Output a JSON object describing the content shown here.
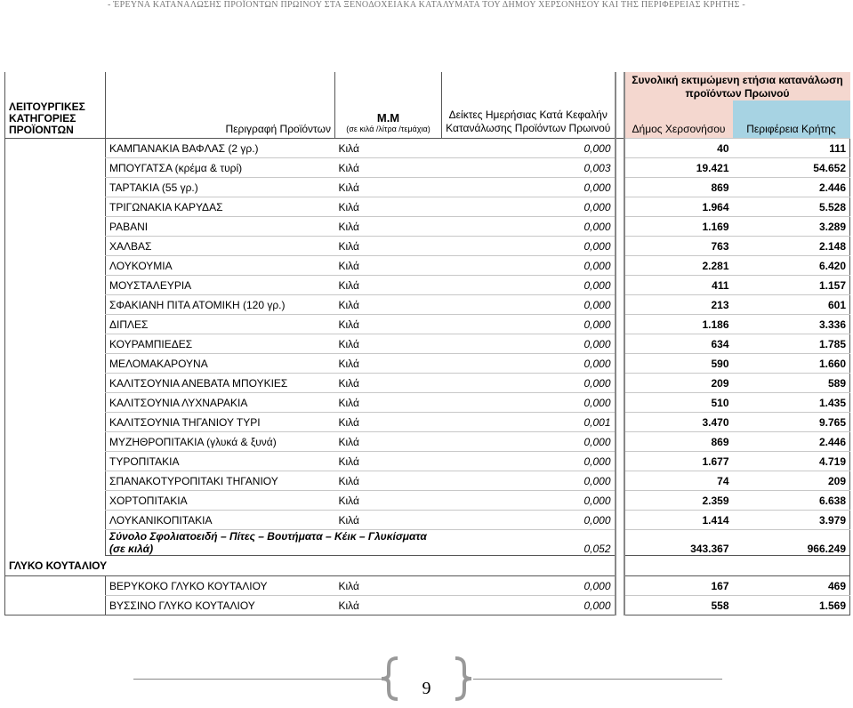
{
  "running_header": "- ΈΡΕΥΝΑ ΚΑΤΑΝΑΛΩΣΗΣ ΠΡΟΪΟΝΤΩΝ ΠΡΩΙΝΟΥ ΣΤΑ ΞΕΝΟΔΟΧΕΙΑΚΑ ΚΑΤΑΛΥΜΑΤΑ ΤΟΥ ΔΗΜΟΥ ΧΕΡΣΟΝΗΣΟΥ ΚΑΙ ΤΗΣ ΠΕΡΙΦΕΡΕΙΑΣ ΚΡΗΤΗΣ -",
  "header": {
    "category": "ΛΕΙΤΟΥΡΓΙΚΕΣ ΚΑΤΗΓΟΡΙΕΣ ΠΡΟΪΟΝΤΩΝ",
    "description": "Περιγραφή Προϊόντων",
    "unit_main": "Μ.Μ",
    "unit_sub": "(σε κιλά /λίτρα /τεμάχια)",
    "index": "Δείκτες Ημερήσιας Κατά Κεφαλήν Κατανάλωσης Προϊόντων Πρωινού",
    "total": "Συνολική εκτιμώμενη ετήσια κατανάλωση προϊόντων Πρωινού",
    "municipality": "Δήμος Χερσονήσου",
    "region": "Περιφέρεια Κρήτης"
  },
  "colors": {
    "peach": "#f4d7cf",
    "blue": "#a7d3e3"
  },
  "rows": [
    {
      "desc": "ΚΑΜΠΑΝΑΚΙΑ ΒΑΦΛΑΣ (2 γρ.)",
      "unit": "Κιλά",
      "index": "0,000",
      "dimos": "40",
      "perif": "111"
    },
    {
      "desc": "ΜΠΟΥΓΑΤΣΑ (κρέμα & τυρί)",
      "unit": "Κιλά",
      "index": "0,003",
      "dimos": "19.421",
      "perif": "54.652"
    },
    {
      "desc": "ΤΑΡΤΑΚΙΑ (55 γρ.)",
      "unit": "Κιλά",
      "index": "0,000",
      "dimos": "869",
      "perif": "2.446"
    },
    {
      "desc": "ΤΡΙΓΩΝΑΚΙΑ ΚΑΡΥΔΑΣ",
      "unit": "Κιλά",
      "index": "0,000",
      "dimos": "1.964",
      "perif": "5.528"
    },
    {
      "desc": "ΡΑΒΑΝΙ",
      "unit": "Κιλά",
      "index": "0,000",
      "dimos": "1.169",
      "perif": "3.289"
    },
    {
      "desc": "ΧΑΛΒΑΣ",
      "unit": "Κιλά",
      "index": "0,000",
      "dimos": "763",
      "perif": "2.148"
    },
    {
      "desc": "ΛΟΥΚΟΥΜΙΑ",
      "unit": "Κιλά",
      "index": "0,000",
      "dimos": "2.281",
      "perif": "6.420"
    },
    {
      "desc": "ΜΟΥΣΤΑΛΕΥΡΙΑ",
      "unit": "Κιλά",
      "index": "0,000",
      "dimos": "411",
      "perif": "1.157"
    },
    {
      "desc": "ΣΦΑΚΙΑΝΗ ΠΙΤΑ ΑΤΟΜΙΚΗ (120 γρ.)",
      "unit": "Κιλά",
      "index": "0,000",
      "dimos": "213",
      "perif": "601"
    },
    {
      "desc": "ΔΙΠΛΕΣ",
      "unit": "Κιλά",
      "index": "0,000",
      "dimos": "1.186",
      "perif": "3.336"
    },
    {
      "desc": "ΚΟΥΡΑΜΠΙΕΔΕΣ",
      "unit": "Κιλά",
      "index": "0,000",
      "dimos": "634",
      "perif": "1.785"
    },
    {
      "desc": "ΜΕΛΟΜΑΚΑΡΟΥΝΑ",
      "unit": "Κιλά",
      "index": "0,000",
      "dimos": "590",
      "perif": "1.660"
    },
    {
      "desc": "ΚΑΛΙΤΣΟΥΝΙΑ ΑΝΕΒΑΤΑ ΜΠΟΥΚΙΕΣ",
      "unit": "Κιλά",
      "index": "0,000",
      "dimos": "209",
      "perif": "589"
    },
    {
      "desc": "ΚΑΛΙΤΣΟΥΝΙΑ ΛΥΧΝΑΡΑΚΙΑ",
      "unit": "Κιλά",
      "index": "0,000",
      "dimos": "510",
      "perif": "1.435"
    },
    {
      "desc": "ΚΑΛΙΤΣΟΥΝΙΑ ΤΗΓΑΝΙΟΥ ΤΥΡΙ",
      "unit": "Κιλά",
      "index": "0,001",
      "dimos": "3.470",
      "perif": "9.765"
    },
    {
      "desc": "ΜΥΖΗΘΡΟΠΙΤΑΚΙΑ (γλυκά & ξυνά)",
      "unit": "Κιλά",
      "index": "0,000",
      "dimos": "869",
      "perif": "2.446"
    },
    {
      "desc": "ΤΥΡΟΠΙΤΑΚΙΑ",
      "unit": "Κιλά",
      "index": "0,000",
      "dimos": "1.677",
      "perif": "4.719"
    },
    {
      "desc": "ΣΠΑΝΑΚΟΤΥΡΟΠΙΤΑΚΙ ΤΗΓΑΝΙΟΥ",
      "unit": "Κιλά",
      "index": "0,000",
      "dimos": "74",
      "perif": "209"
    },
    {
      "desc": "ΧΟΡΤΟΠΙΤΑΚΙΑ",
      "unit": "Κιλά",
      "index": "0,000",
      "dimos": "2.359",
      "perif": "6.638"
    },
    {
      "desc": "ΛΟΥΚΑΝΙΚΟΠΙΤΑΚΙΑ",
      "unit": "Κιλά",
      "index": "0,000",
      "dimos": "1.414",
      "perif": "3.979"
    }
  ],
  "subtotal": {
    "label": "Σύνολο Σφολιατοειδή – Πίτες – Βουτήματα – Κέικ – Γλυκίσματα (σε κιλά)",
    "index": "0,052",
    "dimos": "343.367",
    "perif": "966.249"
  },
  "category_2": "ΓΛΥΚΟ ΚΟΥΤΑΛΙΟΥ",
  "rows_2": [
    {
      "desc": "ΒΕΡΥΚΟΚΟ ΓΛΥΚΟ ΚΟΥΤΑΛΙΟΥ",
      "unit": "Κιλά",
      "index": "0,000",
      "dimos": "167",
      "perif": "469"
    },
    {
      "desc": "ΒΥΣΣΙΝΟ ΓΛΥΚΟ ΚΟΥΤΑΛΙΟΥ",
      "unit": "Κιλά",
      "index": "0,000",
      "dimos": "558",
      "perif": "1.569"
    }
  ],
  "page_number": "9"
}
